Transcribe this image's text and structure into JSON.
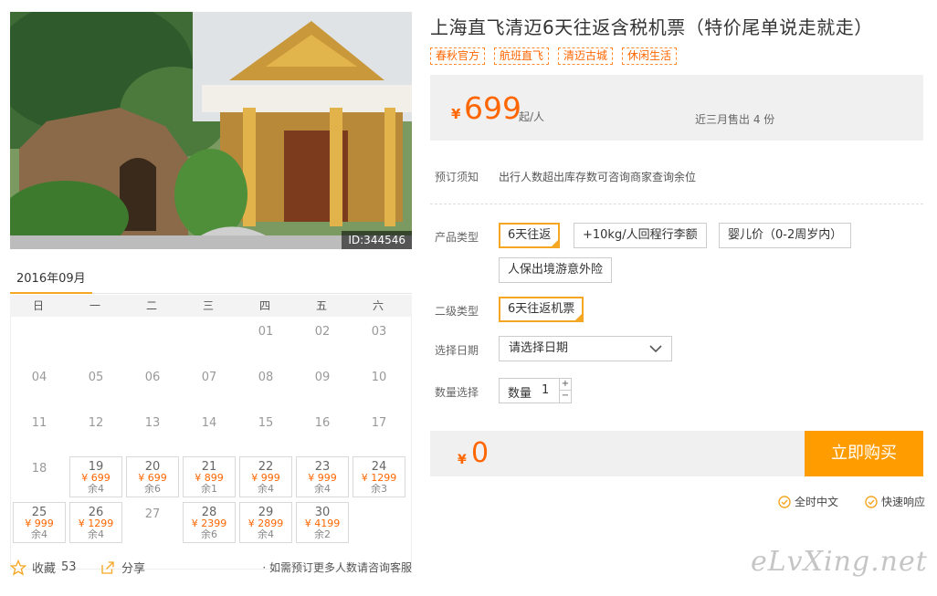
{
  "product": {
    "title": "上海直飞清迈6天往返含税机票（特价尾单说走就走）",
    "tags": [
      "春秋官方",
      "航班直飞",
      "清迈古城",
      "休闲生活"
    ],
    "photo_id": "ID:344546"
  },
  "price": {
    "currency": "¥",
    "amount": "699",
    "unit": "起/人",
    "sold": "近三月售出 4 份"
  },
  "booking": {
    "notice_label": "预订须知",
    "notice_text": "出行人数超出库存数可咨询商家查询余位",
    "type_label": "产品类型",
    "types": [
      "6天往返",
      "+10kg/人回程行李额",
      "婴儿价（0-2周岁内）",
      "人保出境游意外险"
    ],
    "selected_type": "6天往返",
    "subtype_label": "二级类型",
    "subtypes": [
      "6天往返机票"
    ],
    "date_label": "选择日期",
    "date_placeholder": "请选择日期",
    "qty_label": "数量选择",
    "qty_field_label": "数量",
    "qty_value": "1",
    "qty_plus": "+",
    "qty_minus": "−"
  },
  "total": {
    "currency": "¥",
    "amount": "0",
    "buy_label": "立即购买"
  },
  "guarantees": [
    "全时中文",
    "快速响应"
  ],
  "calendar": {
    "month": "2016年09月",
    "weekdays": [
      "日",
      "一",
      "二",
      "三",
      "四",
      "五",
      "六"
    ],
    "leading_blanks": 4,
    "days": [
      {
        "d": "01"
      },
      {
        "d": "02"
      },
      {
        "d": "03"
      },
      {
        "d": "04"
      },
      {
        "d": "05"
      },
      {
        "d": "06"
      },
      {
        "d": "07"
      },
      {
        "d": "08"
      },
      {
        "d": "09"
      },
      {
        "d": "10"
      },
      {
        "d": "11"
      },
      {
        "d": "12"
      },
      {
        "d": "13"
      },
      {
        "d": "14"
      },
      {
        "d": "15"
      },
      {
        "d": "16"
      },
      {
        "d": "17"
      },
      {
        "d": "18"
      },
      {
        "d": "19",
        "price": "¥ 699",
        "stock": "余4"
      },
      {
        "d": "20",
        "price": "¥ 699",
        "stock": "余6"
      },
      {
        "d": "21",
        "price": "¥ 899",
        "stock": "余1"
      },
      {
        "d": "22",
        "price": "¥ 999",
        "stock": "余4"
      },
      {
        "d": "23",
        "price": "¥ 999",
        "stock": "余4"
      },
      {
        "d": "24",
        "price": "¥ 1299",
        "stock": "余3"
      },
      {
        "d": "25",
        "price": "¥ 999",
        "stock": "余4"
      },
      {
        "d": "26",
        "price": "¥ 1299",
        "stock": "余4"
      },
      {
        "d": "27"
      },
      {
        "d": "28",
        "price": "¥ 2399",
        "stock": "余6"
      },
      {
        "d": "29",
        "price": "¥ 2899",
        "stock": "余4"
      },
      {
        "d": "30",
        "price": "¥ 4199",
        "stock": "余2"
      }
    ]
  },
  "actions": {
    "favorite_label": "收藏",
    "favorite_count": "53",
    "share_label": "分享",
    "contact_note": "· 如需预订更多人数请咨询客服"
  },
  "watermark": "eLvXing.net",
  "colors": {
    "accent": "#ff6600",
    "button": "#ff9c00",
    "selected_border": "#f5a623"
  }
}
